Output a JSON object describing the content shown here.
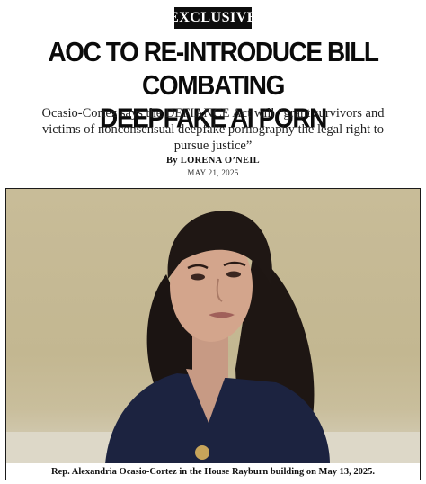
{
  "badge": "EXCLUSIVE",
  "headline": {
    "line1": "AOC TO RE-INTRODUCE BILL COMBATING",
    "line2": "DEEPFAKE AI PORN"
  },
  "dek": "Ocasio-Cortez says the DEFIANCE Act will “grant survivors and victims of nonconsensual deepfake pornography the legal right to pursue justice”",
  "byline": "By LORENA O’NEIL",
  "date": "MAY 21, 2025",
  "photo": {
    "caption": "Rep. Alexandria Ocasio-Cortez in the House Rayburn building on May 13, 2025."
  }
}
